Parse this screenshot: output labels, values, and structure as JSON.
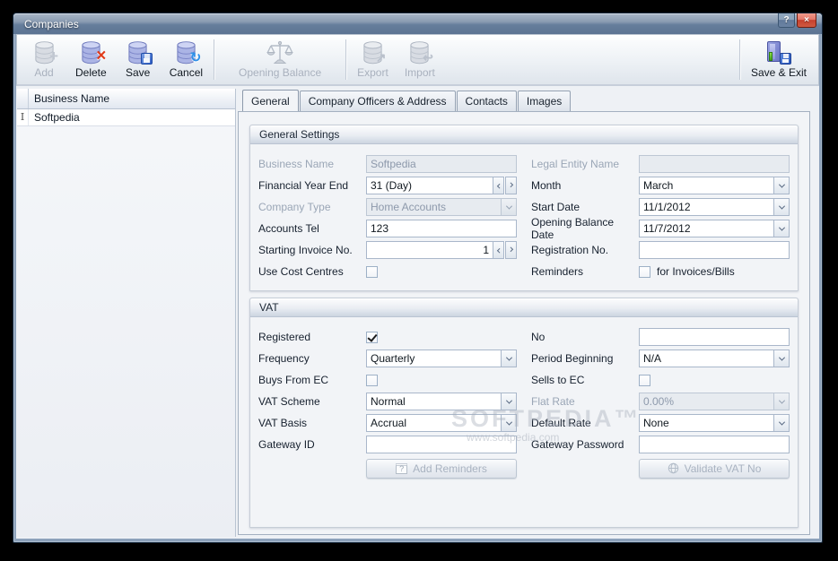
{
  "window": {
    "title": "Companies",
    "help_glyph": "?",
    "close_glyph": "×"
  },
  "colors": {
    "titlebar": "#5d7494",
    "close_button": "#c6402c",
    "delete_badge": "#e03a19",
    "save_badge": "#2f5fc4",
    "cancel_badge": "#2f90e8",
    "toolbar_icon": "#abb4e5"
  },
  "icons": {
    "add_badge": "+",
    "delete_badge": "×",
    "cancel_badge": "↻",
    "export_badge": "↗",
    "import_badge": "↩",
    "ibeam": "I",
    "reminder_glyph": "?"
  },
  "toolbar": {
    "buttons": [
      {
        "label": "Add",
        "enabled": false
      },
      {
        "label": "Delete",
        "enabled": true
      },
      {
        "label": "Save",
        "enabled": true
      },
      {
        "label": "Cancel",
        "enabled": true
      },
      {
        "label": "Opening Balance",
        "enabled": false
      },
      {
        "label": "Export",
        "enabled": false
      },
      {
        "label": "Import",
        "enabled": false
      },
      {
        "label": "Save & Exit",
        "enabled": true
      }
    ]
  },
  "list": {
    "header": "Business Name",
    "rows": [
      {
        "name": "Softpedia"
      }
    ]
  },
  "tabs": [
    {
      "label": "General",
      "active": true
    },
    {
      "label": "Company Officers & Address",
      "active": false
    },
    {
      "label": "Contacts",
      "active": false
    },
    {
      "label": "Images",
      "active": false
    }
  ],
  "general": {
    "title": "General Settings",
    "left": [
      {
        "label": "Business Name",
        "value": "Softpedia",
        "control": "text",
        "disabled": true
      },
      {
        "label": "Financial Year End",
        "value": "31 (Day)",
        "control": "spinner",
        "disabled": false
      },
      {
        "label": "Company Type",
        "value": "Home Accounts",
        "control": "select",
        "disabled": true
      },
      {
        "label": "Accounts Tel",
        "value": "123",
        "control": "text",
        "disabled": false
      },
      {
        "label": "Starting Invoice No.",
        "value": "1",
        "control": "spinner",
        "disabled": false
      },
      {
        "label": "Use Cost Centres",
        "checked": false,
        "control": "checkbox",
        "disabled": false
      }
    ],
    "right": [
      {
        "label": "Legal Entity Name",
        "value": "",
        "control": "text",
        "disabled": true
      },
      {
        "label": "Month",
        "value": "March",
        "control": "select",
        "disabled": false
      },
      {
        "label": "Start Date",
        "value": "11/1/2012",
        "control": "select",
        "disabled": false
      },
      {
        "label": "Opening Balance Date",
        "value": "11/7/2012",
        "control": "select",
        "disabled": false
      },
      {
        "label": "Registration No.",
        "value": "",
        "control": "text",
        "disabled": false
      },
      {
        "label": "Reminders",
        "checked": false,
        "suffix": "for Invoices/Bills",
        "control": "checkbox",
        "disabled": false
      }
    ]
  },
  "vat": {
    "title": "VAT",
    "left": [
      {
        "label": "Registered",
        "checked": true,
        "control": "checkbox",
        "disabled": false
      },
      {
        "label": "Frequency",
        "value": "Quarterly",
        "control": "select",
        "disabled": false
      },
      {
        "label": "Buys From EC",
        "checked": false,
        "control": "checkbox",
        "disabled": false
      },
      {
        "label": "VAT Scheme",
        "value": "Normal",
        "control": "select",
        "disabled": false
      },
      {
        "label": "VAT Basis",
        "value": "Accrual",
        "control": "select",
        "disabled": false
      },
      {
        "label": "Gateway ID",
        "value": "",
        "control": "text",
        "disabled": false
      }
    ],
    "right": [
      {
        "label": "No",
        "value": "",
        "control": "text",
        "disabled": false
      },
      {
        "label": "Period Beginning",
        "value": "N/A",
        "control": "select",
        "disabled": false
      },
      {
        "label": "Sells to EC",
        "checked": false,
        "control": "checkbox",
        "disabled": false
      },
      {
        "label": "Flat Rate",
        "value": "0.00%",
        "control": "select",
        "disabled": true
      },
      {
        "label": "Default Rate",
        "value": "None",
        "control": "select",
        "disabled": false
      },
      {
        "label": "Gateway Password",
        "value": "",
        "control": "text",
        "disabled": false
      }
    ],
    "buttons": {
      "add_reminders": "Add Reminders",
      "validate_vat": "Validate VAT No"
    }
  },
  "watermark": {
    "line1": "SOFTPEDIA™",
    "line2": "www.softpedia.com"
  }
}
